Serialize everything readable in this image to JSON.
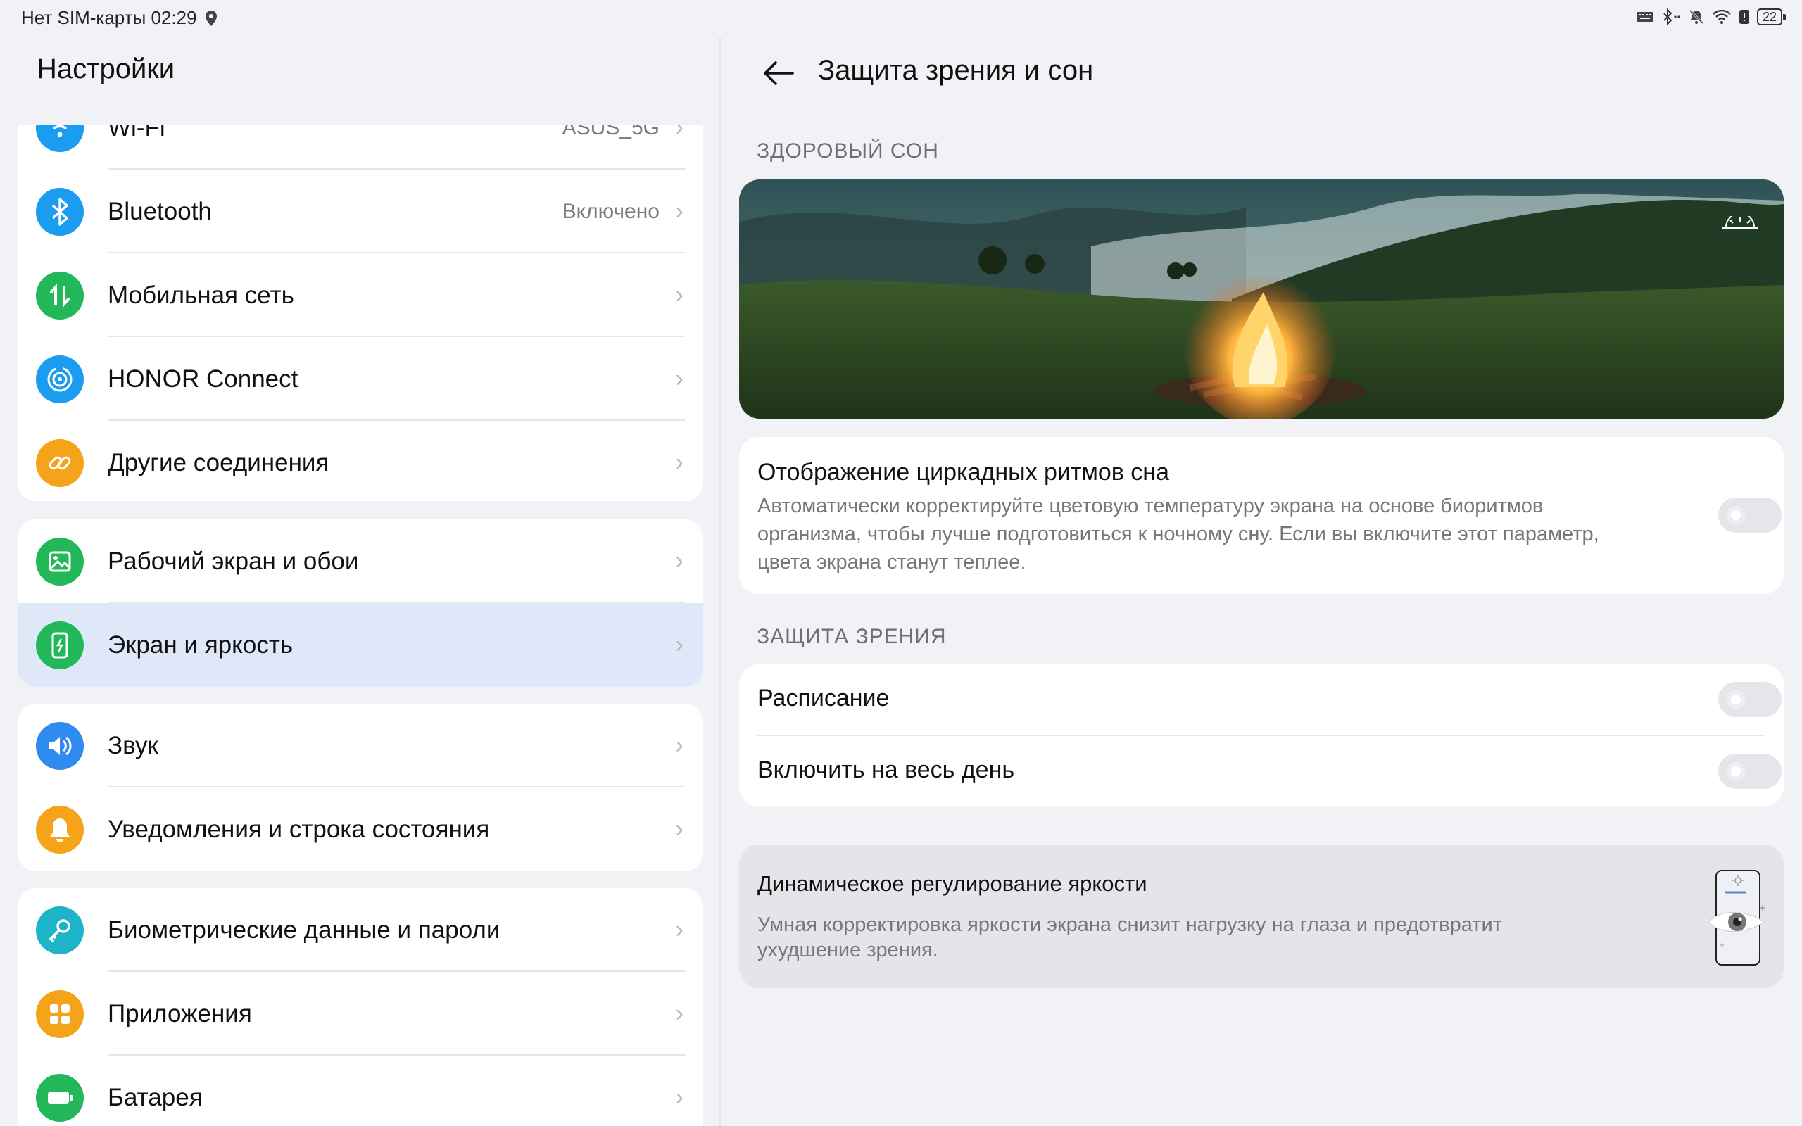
{
  "status_bar": {
    "left_text": "Нет SIM-карты 02:29",
    "battery": "22"
  },
  "left": {
    "title": "Настройки",
    "partial_item": {
      "label": "Wi-Fi",
      "value": "ASUS_5G"
    },
    "groups": [
      {
        "items": [
          {
            "label": "Bluetooth",
            "value": "Включено",
            "icon": "bluetooth-icon"
          },
          {
            "label": "Мобильная сеть",
            "icon": "mobile-network-icon"
          },
          {
            "label": "HONOR Connect",
            "icon": "honor-connect-icon"
          },
          {
            "label": "Другие соединения",
            "icon": "link-icon"
          }
        ]
      },
      {
        "items": [
          {
            "label": "Рабочий экран и обои",
            "icon": "wallpaper-icon"
          },
          {
            "label": "Экран и яркость",
            "icon": "display-brightness-icon",
            "selected": true
          }
        ]
      },
      {
        "items": [
          {
            "label": "Звук",
            "icon": "sound-icon"
          },
          {
            "label": "Уведомления и строка состояния",
            "icon": "bell-icon"
          }
        ]
      },
      {
        "items": [
          {
            "label": "Биометрические данные и пароли",
            "icon": "key-icon"
          },
          {
            "label": "Приложения",
            "icon": "apps-icon"
          },
          {
            "label": "Батарея",
            "icon": "battery-icon"
          }
        ]
      }
    ]
  },
  "right": {
    "title": "Защита зрения и сон",
    "section_sleep": "ЗДОРОВЫЙ СОН",
    "circadian": {
      "title": "Отображение циркадных ритмов сна",
      "desc_line1": "Автоматически корректируйте цветовую температуру экрана на основе биоритмов",
      "desc_line2": "организма, чтобы лучше подготовиться к ночному сну. Если вы включите этот параметр,",
      "desc_line3": "цвета экрана станут теплее.",
      "enabled": false
    },
    "section_eye": "ЗАЩИТА ЗРЕНИЯ",
    "schedule": {
      "label": "Расписание",
      "enabled": false
    },
    "all_day": {
      "label": "Включить на весь день",
      "enabled": false
    },
    "dynamic": {
      "title": "Динамическое регулирование яркости",
      "desc_line1": "Умная корректировка яркости экрана снизит нагрузку на глаза и предотвратит",
      "desc_line2": "ухудшение зрения."
    }
  },
  "colors": {
    "accent_selected_bg": "#dfe8f8",
    "toggle_off": "#e5e6ea"
  }
}
